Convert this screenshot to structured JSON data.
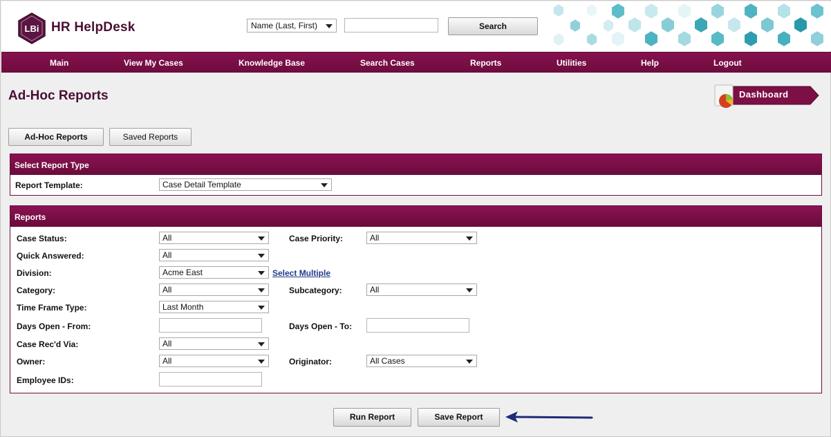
{
  "brand": {
    "logo_badge": "LBi",
    "name": "HR HelpDesk",
    "color": "#4a0f33"
  },
  "search": {
    "type_value": "Name (Last, First)",
    "input_value": "",
    "button_label": "Search"
  },
  "nav": [
    "Main",
    "View My Cases",
    "Knowledge Base",
    "Search Cases",
    "Reports",
    "Utilities",
    "Help",
    "Logout"
  ],
  "page": {
    "title": "Ad-Hoc Reports",
    "dashboard_label": "Dashboard"
  },
  "tabs": [
    {
      "label": "Ad-Hoc Reports",
      "active": true
    },
    {
      "label": "Saved Reports",
      "active": false
    }
  ],
  "report_type": {
    "header": "Select Report Type",
    "template_label": "Report Template:",
    "template_value": "Case Detail Template"
  },
  "reports": {
    "header": "Reports",
    "case_status": {
      "label": "Case Status:",
      "value": "All"
    },
    "case_priority": {
      "label": "Case Priority:",
      "value": "All"
    },
    "quick_answered": {
      "label": "Quick Answered:",
      "value": "All"
    },
    "division": {
      "label": "Division:",
      "value": "Acme East",
      "link": "Select Multiple"
    },
    "category": {
      "label": "Category:",
      "value": "All"
    },
    "subcategory": {
      "label": "Subcategory:",
      "value": "All"
    },
    "time_frame": {
      "label": "Time Frame Type:",
      "value": "Last Month"
    },
    "days_open_from": {
      "label": "Days Open - From:",
      "value": ""
    },
    "days_open_to": {
      "label": "Days Open - To:",
      "value": ""
    },
    "rec_via": {
      "label": "Case Rec'd Via:",
      "value": "All"
    },
    "owner": {
      "label": "Owner:",
      "value": "All"
    },
    "originator": {
      "label": "Originator:",
      "value": "All Cases"
    },
    "employee_ids": {
      "label": "Employee IDs:",
      "value": ""
    }
  },
  "actions": {
    "run": "Run Report",
    "save": "Save Report"
  },
  "colors": {
    "brand": "#6d0c3e",
    "link": "#213a8a",
    "annotation_arrow": "#1e2a78",
    "hex_teal": "#4bb3c1"
  }
}
